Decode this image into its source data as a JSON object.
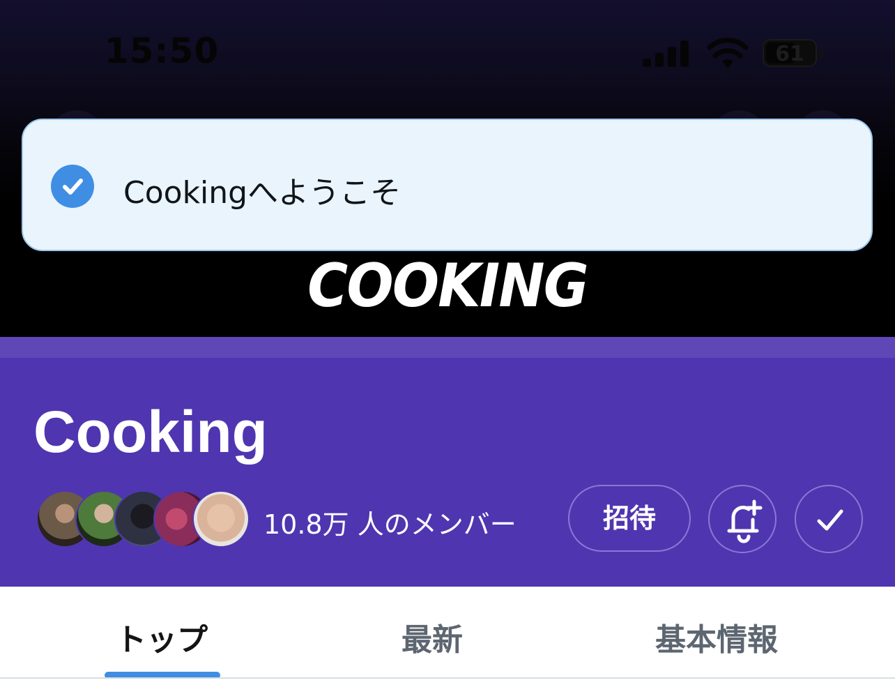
{
  "status_bar": {
    "time": "15:50",
    "battery": "61"
  },
  "banner": {
    "logo_text": "COOKING"
  },
  "toast": {
    "message": "Cookingへようこそ",
    "icon": "check-circle-icon",
    "background": "#e9f4fd",
    "accent": "#3f8ee3"
  },
  "community": {
    "name": "Cooking",
    "members_label": "10.8万 人のメンバー",
    "header_color": "#4f36b0",
    "avatars": [
      {
        "name": "member-avatar-1",
        "color": "#6b5a48"
      },
      {
        "name": "member-avatar-2",
        "color": "#4e7a3c"
      },
      {
        "name": "member-avatar-3",
        "color": "#2d3142"
      },
      {
        "name": "member-avatar-4",
        "color": "#8a2d5a"
      },
      {
        "name": "member-avatar-5",
        "color": "#d9b49a"
      }
    ],
    "actions": {
      "invite_label": "招待",
      "notify_icon": "bell-plus-icon",
      "joined_icon": "checkmark-icon"
    }
  },
  "tabs": [
    {
      "label": "トップ",
      "active": true
    },
    {
      "label": "最新",
      "active": false
    },
    {
      "label": "基本情報",
      "active": false
    }
  ]
}
